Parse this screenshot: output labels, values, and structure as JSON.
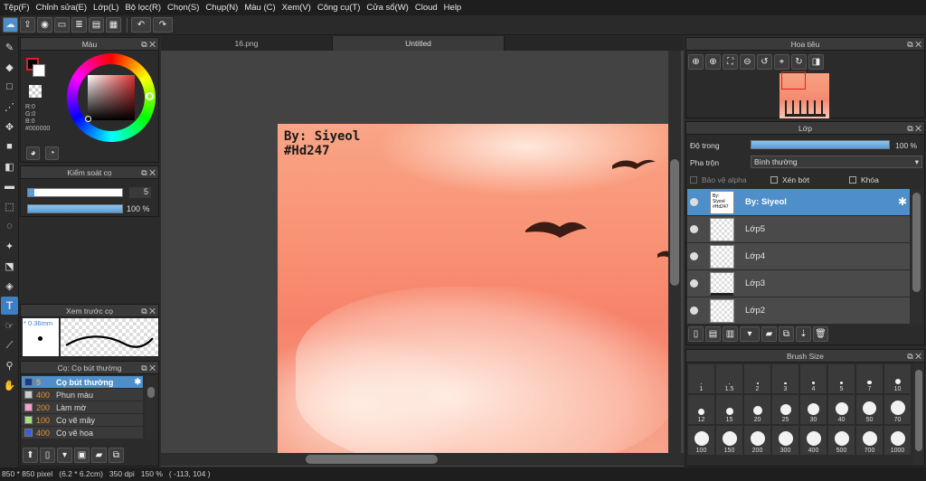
{
  "menu": [
    "Tệp(F)",
    "Chỉnh sửa(E)",
    "Lớp(L)",
    "Bộ lọc(R)",
    "Chọn(S)",
    "Chụp(N)",
    "Màu (C)",
    "Xem(V)",
    "Công cụ(T)",
    "Cửa sổ(W)",
    "Cloud",
    "Help"
  ],
  "tabs": [
    "16.png",
    "Untitled"
  ],
  "color_panel": {
    "title": "Màu",
    "r": "R:0",
    "g": "G:0",
    "b": "B:0",
    "hex": "#000000"
  },
  "brush_ctrl": {
    "title": "Kiểm soát cọ",
    "size": "5",
    "opacity": "100 %",
    "opacity_fraction": 1.0
  },
  "preview": {
    "title": "Xem trước cọ",
    "size": "* 0.36mm"
  },
  "brush_list": {
    "title": "Cọ: Cọ bút thường",
    "items": [
      {
        "size": "5",
        "name": "Cọ bút thường",
        "color": "#1e3a8a",
        "selected": true
      },
      {
        "size": "400",
        "name": "Phun màu",
        "color": "#cccccc"
      },
      {
        "size": "200",
        "name": "Làm mờ",
        "color": "#f4a0c8"
      },
      {
        "size": "100",
        "name": "Cọ vẽ mây",
        "color": "#a8e07a"
      },
      {
        "size": "400",
        "name": "Cọ vẽ hoa",
        "color": "#3c5fd8"
      }
    ]
  },
  "canvas": {
    "text1": "By: Siyeol",
    "text2": "#Hd247"
  },
  "navigator": {
    "title": "Hoa tiêu"
  },
  "layer_panel": {
    "title": "Lớp",
    "opacity_label": "Độ trong",
    "opacity_value": "100 %",
    "opacity_fraction": 1.0,
    "blend_label": "Pha trộn",
    "blend_value": "Bình thường",
    "protect_alpha": "Bảo vệ alpha",
    "clip": "Xén bớt",
    "lock": "Khóa",
    "layers": [
      {
        "name": "By: Siyeol",
        "selected": true
      },
      {
        "name": "Lớp5"
      },
      {
        "name": "Lớp4"
      },
      {
        "name": "Lớp3"
      },
      {
        "name": "Lớp2"
      }
    ]
  },
  "brush_size": {
    "title": "Brush Size",
    "labels": [
      "1",
      "1.5",
      "2",
      "3",
      "4",
      "5",
      "7",
      "10",
      "12",
      "15",
      "20",
      "25",
      "30",
      "40",
      "50",
      "70",
      "100",
      "150",
      "200",
      "300",
      "400",
      "500",
      "700",
      "1000"
    ]
  },
  "status": {
    "pixels": "850 * 850 pixel",
    "cm": "(6.2 * 6.2cm)",
    "dpi": "350 dpi",
    "zoom": "150 %",
    "coords": "( -113, 104 )"
  }
}
